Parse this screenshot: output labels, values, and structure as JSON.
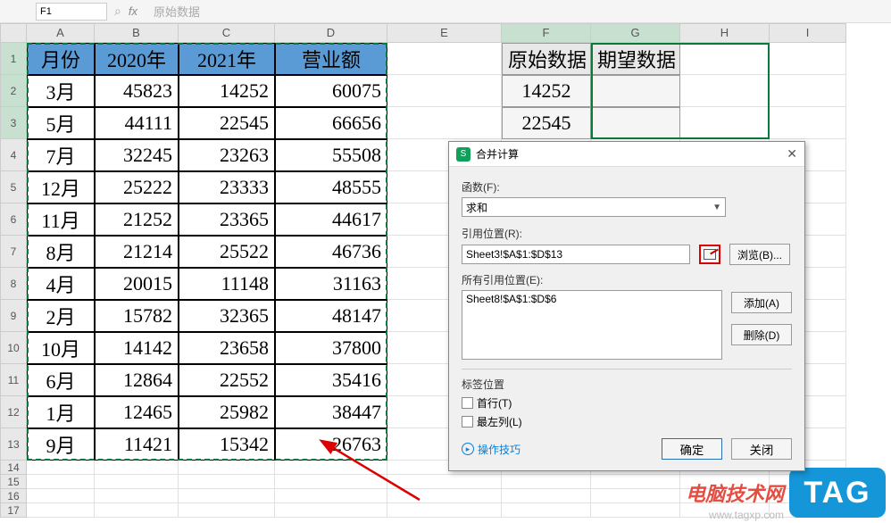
{
  "top": {
    "name_box": "F1",
    "formula_hint": "原始数据"
  },
  "columns": [
    "A",
    "B",
    "C",
    "D",
    "E",
    "F",
    "G",
    "H",
    "I"
  ],
  "chart_data": {
    "type": "table",
    "title": "",
    "headers": [
      "月份",
      "2020年",
      "2021年",
      "营业额"
    ],
    "rows": [
      [
        "3月",
        45823,
        14252,
        60075
      ],
      [
        "5月",
        44111,
        22545,
        66656
      ],
      [
        "7月",
        32245,
        23263,
        55508
      ],
      [
        "12月",
        25222,
        23333,
        48555
      ],
      [
        "11月",
        21252,
        23365,
        44617
      ],
      [
        "8月",
        21214,
        25522,
        46736
      ],
      [
        "4月",
        20015,
        11148,
        31163
      ],
      [
        "2月",
        15782,
        32365,
        48147
      ],
      [
        "10月",
        14142,
        23658,
        37800
      ],
      [
        "6月",
        12864,
        22552,
        35416
      ],
      [
        "1月",
        12465,
        25982,
        38447
      ],
      [
        "9月",
        11421,
        15342,
        26763
      ]
    ]
  },
  "side_table": {
    "headers": [
      "原始数据",
      "期望数据"
    ],
    "rows": [
      [
        14252,
        ""
      ],
      [
        22545,
        ""
      ]
    ]
  },
  "dialog": {
    "title": "合并计算",
    "function_label": "函数(F):",
    "function_value": "求和",
    "ref_label": "引用位置(R):",
    "ref_value": "Sheet3!$A$1:$D$13",
    "browse": "浏览(B)...",
    "all_refs_label": "所有引用位置(E):",
    "all_refs_item": "Sheet8!$A$1:$D$6",
    "add": "添加(A)",
    "delete": "删除(D)",
    "label_position": "标签位置",
    "top_row": "首行(T)",
    "left_col": "最左列(L)",
    "tips": "操作技巧",
    "ok": "确定",
    "close": "关闭"
  },
  "watermark": {
    "text": "电脑技术网",
    "url": "www.tagxp.com",
    "badge": "TAG"
  }
}
